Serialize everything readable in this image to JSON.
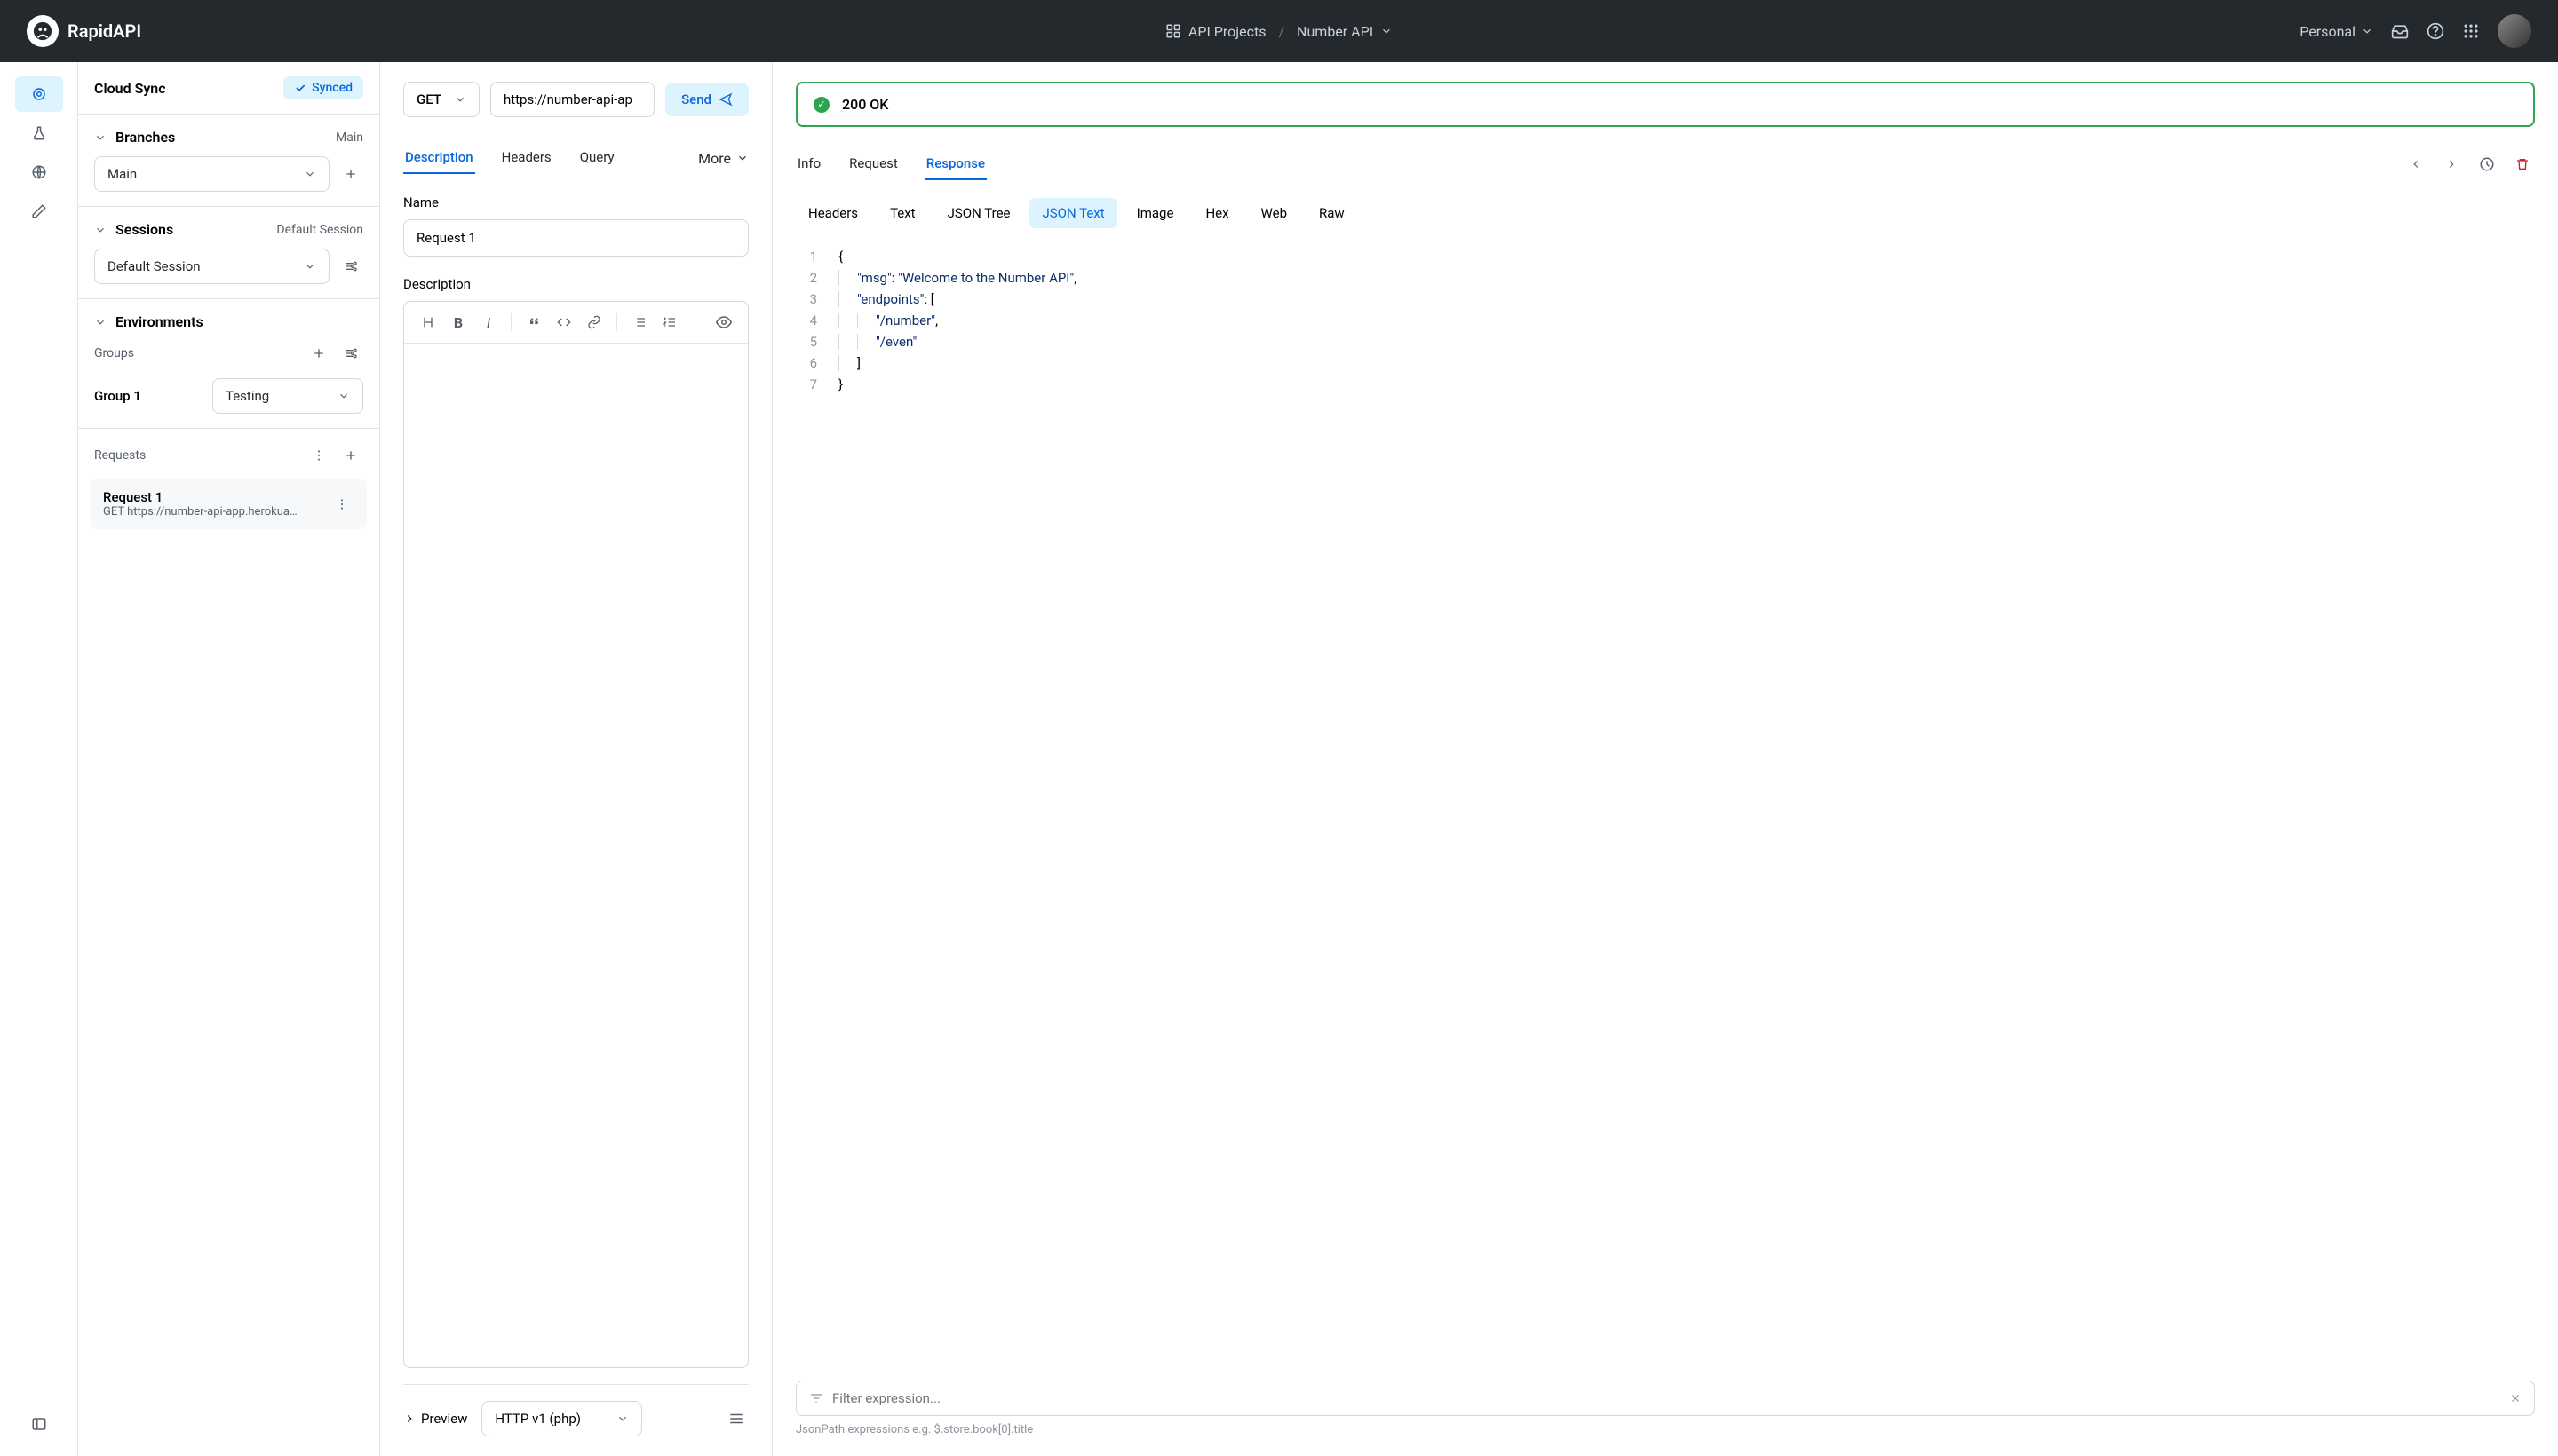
{
  "brand": "RapidAPI",
  "breadcrumb": {
    "projects": "API Projects",
    "current": "Number API"
  },
  "account": "Personal",
  "sidebar": {
    "cloud_sync": {
      "title": "Cloud Sync",
      "badge": "Synced"
    },
    "branches": {
      "label": "Branches",
      "current": "Main",
      "selected": "Main"
    },
    "sessions": {
      "label": "Sessions",
      "current": "Default Session",
      "selected": "Default Session"
    },
    "environments": {
      "label": "Environments",
      "groups_label": "Groups",
      "group": "Group 1",
      "env_selected": "Testing"
    },
    "requests": {
      "label": "Requests",
      "items": [
        {
          "name": "Request 1",
          "sub": "GET https://number-api-app.herokua…"
        }
      ]
    }
  },
  "request_panel": {
    "method": "GET",
    "url": "https://number-api-ap",
    "send": "Send",
    "tabs": [
      "Description",
      "Headers",
      "Query"
    ],
    "more": "More",
    "name_label": "Name",
    "name_value": "Request 1",
    "desc_label": "Description",
    "preview_label": "Preview",
    "lang": "HTTP v1 (php)"
  },
  "response_panel": {
    "status": "200 OK",
    "tabs": [
      "Info",
      "Request",
      "Response"
    ],
    "sub_tabs": [
      "Headers",
      "Text",
      "JSON Tree",
      "JSON Text",
      "Image",
      "Hex",
      "Web",
      "Raw"
    ],
    "active_sub": "JSON Text",
    "filter_placeholder": "Filter expression...",
    "hint": "JsonPath expressions e.g. $.store.book[0].title",
    "json_lines": [
      {
        "n": "1",
        "indent": 0,
        "html": "{"
      },
      {
        "n": "2",
        "indent": 1,
        "html": "\"msg\": \"Welcome to the Number API\","
      },
      {
        "n": "3",
        "indent": 1,
        "html": "\"endpoints\": ["
      },
      {
        "n": "4",
        "indent": 2,
        "html": "\"/number\","
      },
      {
        "n": "5",
        "indent": 2,
        "html": "\"/even\""
      },
      {
        "n": "6",
        "indent": 1,
        "html": "]"
      },
      {
        "n": "7",
        "indent": 0,
        "html": "}"
      }
    ]
  },
  "chart_data": {
    "type": "table",
    "title": "Response JSON",
    "data": {
      "msg": "Welcome to the Number API",
      "endpoints": [
        "/number",
        "/even"
      ]
    }
  }
}
